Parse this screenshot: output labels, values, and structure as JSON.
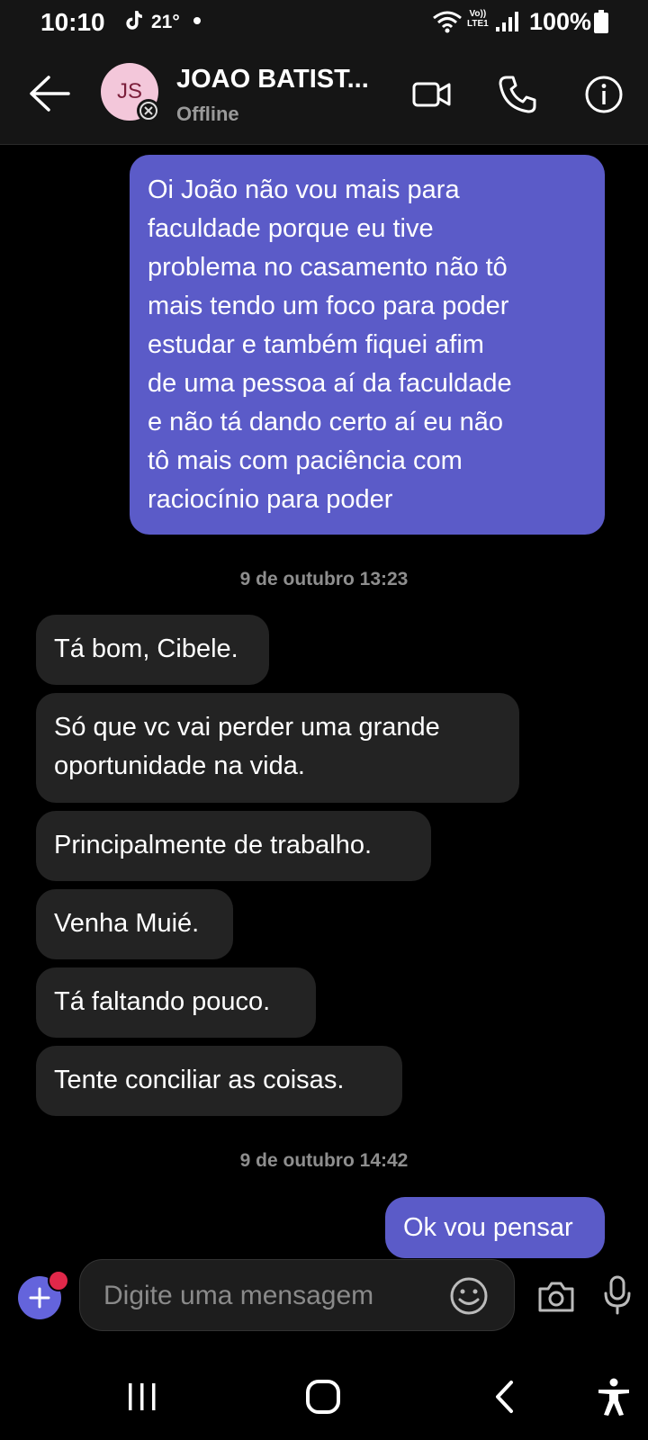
{
  "status_bar": {
    "time": "10:10",
    "temperature": "21°",
    "network_line1": "Vo))",
    "network_line2": "LTE1",
    "battery": "100%"
  },
  "header": {
    "back_icon": "arrow-left-icon",
    "avatar_initials": "JS",
    "contact_name": "JOAO BATIST...",
    "status": "Offline",
    "video_icon": "video-camera-icon",
    "call_icon": "phone-icon",
    "info_icon": "info-icon"
  },
  "messages": [
    {
      "type": "outgoing",
      "text": "Oi João não vou mais para\nfaculdade porque eu tive\nproblema no casamento não tô\nmais tendo um foco para poder\nestudar e também fiquei afim\nde uma pessoa aí da faculdade\ne não tá dando certo aí eu não\ntô mais com paciência com\nraciocínio para poder"
    },
    {
      "type": "timestamp",
      "text": "9 de outubro 13:23"
    },
    {
      "type": "incoming",
      "text": "Tá bom, Cibele."
    },
    {
      "type": "incoming",
      "text": "Só que vc vai perder uma grande\noportunidade na vida."
    },
    {
      "type": "incoming",
      "text": "Principalmente de trabalho."
    },
    {
      "type": "incoming",
      "text": "Venha Muié."
    },
    {
      "type": "incoming",
      "text": "Tá faltando pouco."
    },
    {
      "type": "incoming",
      "text": "Tente conciliar as coisas."
    },
    {
      "type": "timestamp",
      "text": "9 de outubro 14:42"
    },
    {
      "type": "outgoing",
      "text": "Ok vou pensar"
    }
  ],
  "composer": {
    "placeholder": "Digite uma mensagem",
    "add_icon": "plus-icon",
    "emoji_icon": "emoji-icon",
    "camera_icon": "camera-icon",
    "mic_icon": "microphone-icon"
  },
  "navigation": {
    "recents_icon": "recents-icon",
    "home_icon": "home-icon",
    "back_icon": "back-icon",
    "accessibility_icon": "accessibility-icon"
  },
  "colors": {
    "outgoing_bubble": "#5b5bc8",
    "incoming_bubble": "#232323",
    "background": "#000000",
    "header": "#151515",
    "accent": "#6464dc"
  }
}
